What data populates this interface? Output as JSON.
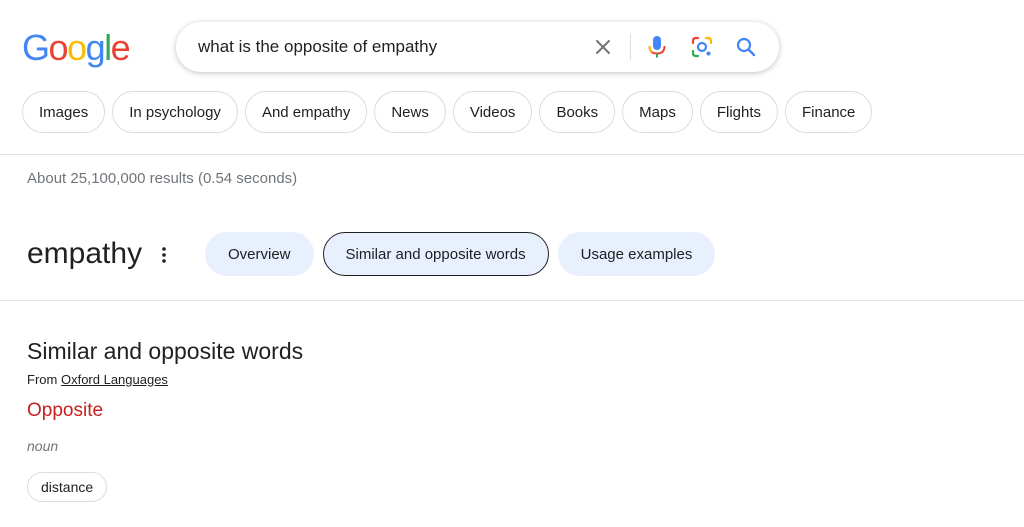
{
  "logo": {
    "letters": [
      {
        "char": "G",
        "color": "#4285F4"
      },
      {
        "char": "o",
        "color": "#EA4335"
      },
      {
        "char": "o",
        "color": "#FBBC05"
      },
      {
        "char": "g",
        "color": "#4285F4"
      },
      {
        "char": "l",
        "color": "#34A853"
      },
      {
        "char": "e",
        "color": "#EA4335"
      }
    ]
  },
  "search": {
    "query": "what is the opposite of empathy",
    "icons": [
      "clear-icon",
      "mic-icon",
      "lens-icon",
      "search-icon"
    ]
  },
  "chips": [
    {
      "label": "Images"
    },
    {
      "label": "In psychology"
    },
    {
      "label": "And empathy"
    },
    {
      "label": "News"
    },
    {
      "label": "Videos"
    },
    {
      "label": "Books"
    },
    {
      "label": "Maps"
    },
    {
      "label": "Flights"
    },
    {
      "label": "Finance"
    }
  ],
  "result_stats": "About 25,100,000 results (0.54 seconds)",
  "dictionary": {
    "word": "empathy",
    "tabs": [
      {
        "label": "Overview",
        "selected": false
      },
      {
        "label": "Similar and opposite words",
        "selected": true
      },
      {
        "label": "Usage examples",
        "selected": false
      }
    ]
  },
  "section": {
    "title": "Similar and opposite words",
    "source_prefix": "From",
    "source_link": "Oxford Languages",
    "group_label": "Opposite",
    "part_of_speech": "noun",
    "words": [
      "distance"
    ]
  },
  "colors": {
    "opposite_label": "#c5221f",
    "tab_bg": "#e8f0fe"
  }
}
